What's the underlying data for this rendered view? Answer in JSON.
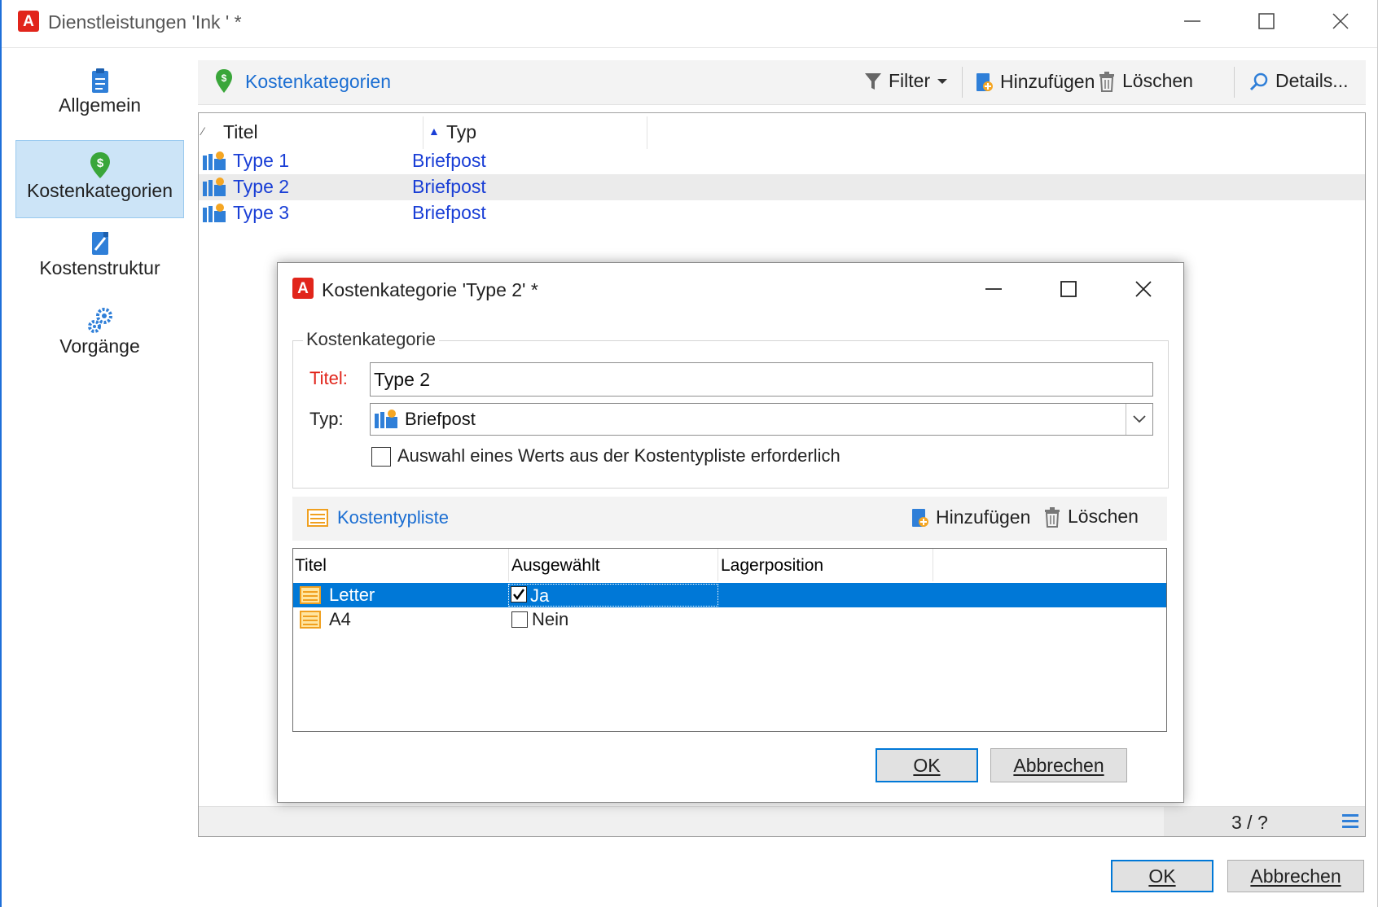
{
  "main_window": {
    "title": "Dienstleistungen 'Ink ' *",
    "logo": "A"
  },
  "sidebar": {
    "items": [
      {
        "label": "Allgemein",
        "icon": "clipboard-icon",
        "selected": false
      },
      {
        "label": "Kostenkategorien",
        "icon": "money-pin-icon",
        "selected": true
      },
      {
        "label": "Kostenstruktur",
        "icon": "edit-document-icon",
        "selected": false
      },
      {
        "label": "Vorgänge",
        "icon": "gears-icon",
        "selected": false
      }
    ]
  },
  "toolbar": {
    "title": "Kostenkategorien",
    "filter_label": "Filter",
    "add_label": "Hinzufügen",
    "delete_label": "Löschen",
    "details_label": "Details..."
  },
  "grid": {
    "columns": [
      "Titel",
      "Typ"
    ],
    "rows": [
      {
        "title": "Type 1",
        "type": "Briefpost"
      },
      {
        "title": "Type 2",
        "type": "Briefpost"
      },
      {
        "title": "Type 3",
        "type": "Briefpost"
      }
    ],
    "status": "3 / ?"
  },
  "dialog": {
    "title": "Kostenkategorie 'Type 2' *",
    "group_label": "Kostenkategorie",
    "title_label": "Titel:",
    "title_value": "Type 2",
    "type_label": "Typ:",
    "type_value": "Briefpost",
    "checkbox_label": "Auswahl eines Werts aus der Kostentypliste erforderlich",
    "checkbox_checked": false,
    "subtoolbar": {
      "title": "Kostentypliste",
      "add_label": "Hinzufügen",
      "delete_label": "Löschen"
    },
    "list": {
      "columns": [
        "Titel",
        "Ausgewählt",
        "Lagerposition"
      ],
      "rows": [
        {
          "title": "Letter",
          "selected": "Ja",
          "checked": true
        },
        {
          "title": "A4",
          "selected": "Nein",
          "checked": false
        }
      ]
    },
    "ok_label": "OK",
    "cancel_label": "Abbrechen"
  },
  "footer": {
    "ok_label": "OK",
    "cancel_label": "Abbrechen"
  },
  "colors": {
    "accent": "#0078d7",
    "link": "#1a3fd6",
    "required": "#e1251b",
    "logo": "#e1251b"
  }
}
